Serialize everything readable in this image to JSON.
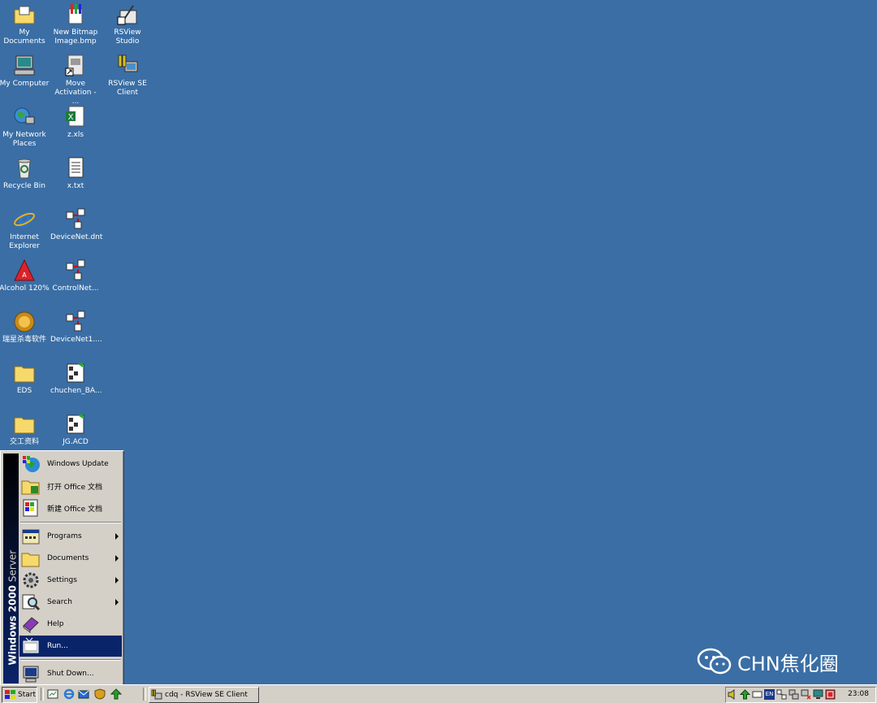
{
  "desktop": {
    "icons": [
      {
        "label": "My Documents"
      },
      {
        "label": "New Bitmap Image.bmp"
      },
      {
        "label": "RSView Studio"
      },
      {
        "label": "My Computer"
      },
      {
        "label": "Move Activation - ..."
      },
      {
        "label": "RSView SE Client"
      },
      {
        "label": "My Network Places"
      },
      {
        "label": "z.xls"
      },
      {
        "label": "Recycle Bin"
      },
      {
        "label": "x.txt"
      },
      {
        "label": "Internet Explorer"
      },
      {
        "label": "DeviceNet.dnt"
      },
      {
        "label": "Alcohol 120%"
      },
      {
        "label": "ControlNet..."
      },
      {
        "label": "瑞星杀毒软件"
      },
      {
        "label": "DeviceNet1...."
      },
      {
        "label": "EDS"
      },
      {
        "label": "chuchen_BA..."
      },
      {
        "label": "交工资料"
      },
      {
        "label": "JG.ACD"
      }
    ]
  },
  "start_menu": {
    "banner_bold": "Windows 2000",
    "banner_light": " Server",
    "items": [
      {
        "label": "Windows Update"
      },
      {
        "label": "打开 Office 文档"
      },
      {
        "label": "新建 Office 文档"
      },
      {
        "label": "Programs"
      },
      {
        "label": "Documents"
      },
      {
        "label": "Settings"
      },
      {
        "label": "Search"
      },
      {
        "label": "Help"
      },
      {
        "label": "Run..."
      },
      {
        "label": "Shut Down..."
      }
    ]
  },
  "taskbar": {
    "start_label": "Start",
    "task_label": "cdq - RSView SE Client",
    "tray_lang": "EN",
    "clock": "23:08"
  },
  "watermark": {
    "text": "CHN焦化圈"
  },
  "colors": {
    "desktop": "#3a6ea5",
    "selection": "#0a246a",
    "face": "#d4d0c8"
  }
}
